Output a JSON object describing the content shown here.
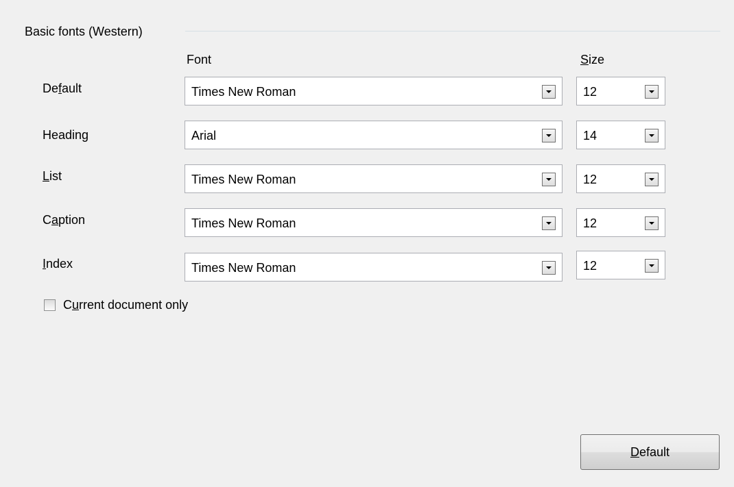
{
  "group": {
    "title": "Basic fonts (Western)"
  },
  "columns": {
    "font_pre": "Font",
    "size_ul": "S",
    "size_rest": "ize"
  },
  "rows": [
    {
      "label_pre": "De",
      "label_ul": "f",
      "label_post": "ault",
      "font": "Times New Roman",
      "size": "12"
    },
    {
      "label_pre": "Headin",
      "label_ul": "g",
      "label_post": "",
      "font": "Arial",
      "size": "14"
    },
    {
      "label_pre": "",
      "label_ul": "L",
      "label_post": "ist",
      "font": "Times New Roman",
      "size": "12"
    },
    {
      "label_pre": "C",
      "label_ul": "a",
      "label_post": "ption",
      "font": "Times New Roman",
      "size": "12"
    },
    {
      "label_pre": "",
      "label_ul": "I",
      "label_post": "ndex",
      "font": "Times New Roman",
      "size": "12"
    }
  ],
  "checkbox": {
    "label_pre": "C",
    "label_ul": "u",
    "label_post": "rrent document only",
    "checked": false
  },
  "button": {
    "label_ul": "D",
    "label_rest": "efault"
  },
  "icons": {
    "dropdown": "chevron-down-icon",
    "checkbox": "checkbox-icon"
  },
  "colors": {
    "background": "#f0f0f0",
    "field_border": "#abadb3",
    "group_line": "#d5dfe5"
  }
}
